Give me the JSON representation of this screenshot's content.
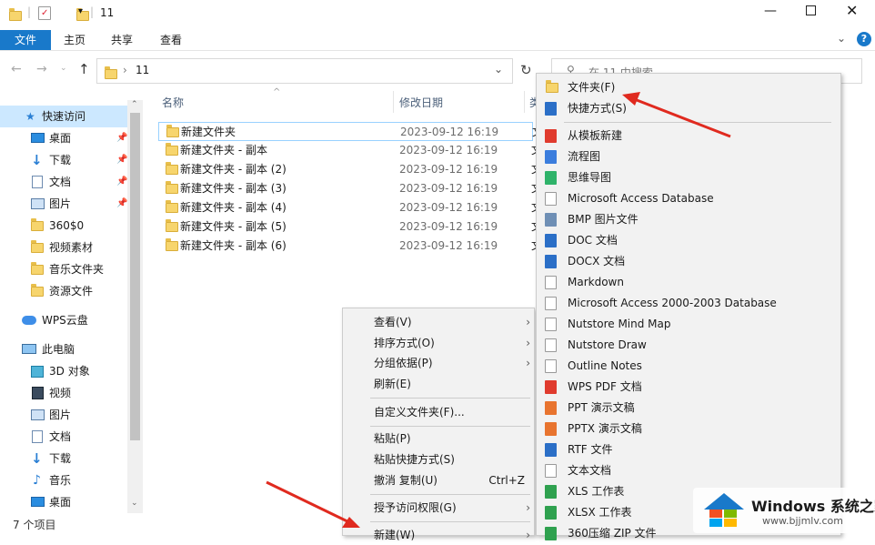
{
  "window": {
    "title": "11",
    "controls": [
      "minimize",
      "maximize",
      "close"
    ]
  },
  "ribbon": {
    "tabs": [
      "文件",
      "主页",
      "共享",
      "查看"
    ]
  },
  "navigation": {
    "address": "11",
    "search_placeholder": "在 11 中搜索"
  },
  "sidebar": {
    "quick_access": "快速访问",
    "items": [
      {
        "label": "桌面",
        "icon": "desktop-icon",
        "pinned": true
      },
      {
        "label": "下载",
        "icon": "download-icon",
        "pinned": true
      },
      {
        "label": "文档",
        "icon": "document-icon",
        "pinned": true
      },
      {
        "label": "图片",
        "icon": "picture-icon",
        "pinned": true
      },
      {
        "label": "360$0",
        "icon": "folder-icon",
        "pinned": false
      },
      {
        "label": "视频素材",
        "icon": "folder-icon",
        "pinned": false
      },
      {
        "label": "音乐文件夹",
        "icon": "folder-icon",
        "pinned": false
      },
      {
        "label": "资源文件",
        "icon": "folder-icon",
        "pinned": false
      }
    ],
    "wps_cloud": "WPS云盘",
    "this_pc": "此电脑",
    "pc_items": [
      {
        "label": "3D 对象",
        "icon": "3d-objects-icon"
      },
      {
        "label": "视频",
        "icon": "video-icon"
      },
      {
        "label": "图片",
        "icon": "picture-icon"
      },
      {
        "label": "文档",
        "icon": "document-icon"
      },
      {
        "label": "下载",
        "icon": "download-icon"
      },
      {
        "label": "音乐",
        "icon": "music-icon"
      },
      {
        "label": "桌面",
        "icon": "desktop-icon"
      }
    ]
  },
  "filelist": {
    "columns": {
      "name": "名称",
      "date": "修改日期",
      "type": "类"
    },
    "rows": [
      {
        "name": "新建文件夹",
        "date": "2023-09-12 16:19",
        "type": "文"
      },
      {
        "name": "新建文件夹 - 副本",
        "date": "2023-09-12 16:19",
        "type": "文"
      },
      {
        "name": "新建文件夹 - 副本 (2)",
        "date": "2023-09-12 16:19",
        "type": "文"
      },
      {
        "name": "新建文件夹 - 副本 (3)",
        "date": "2023-09-12 16:19",
        "type": "文"
      },
      {
        "name": "新建文件夹 - 副本 (4)",
        "date": "2023-09-12 16:19",
        "type": "文"
      },
      {
        "name": "新建文件夹 - 副本 (5)",
        "date": "2023-09-12 16:19",
        "type": "文"
      },
      {
        "name": "新建文件夹 - 副本 (6)",
        "date": "2023-09-12 16:19",
        "type": "文"
      }
    ]
  },
  "status": {
    "item_count": "7 个项目"
  },
  "context_menu": {
    "items": [
      {
        "label": "查看(V)",
        "submenu": true
      },
      {
        "label": "排序方式(O)",
        "submenu": true
      },
      {
        "label": "分组依据(P)",
        "submenu": true
      },
      {
        "label": "刷新(E)",
        "submenu": false
      },
      {
        "label": "自定义文件夹(F)...",
        "submenu": false
      },
      {
        "label": "粘贴(P)",
        "submenu": false
      },
      {
        "label": "粘贴快捷方式(S)",
        "submenu": false
      },
      {
        "label": "撤消 复制(U)",
        "shortcut": "Ctrl+Z",
        "submenu": false
      },
      {
        "label": "授予访问权限(G)",
        "submenu": true
      },
      {
        "label": "新建(W)",
        "submenu": true
      }
    ]
  },
  "new_submenu": {
    "items": [
      {
        "label": "文件夹(F)",
        "icon": "folder-icon",
        "color": "#f7d56d"
      },
      {
        "label": "快捷方式(S)",
        "icon": "shortcut-icon",
        "color": "#2b6fc7"
      },
      {
        "label": "从模板新建",
        "icon": "template-icon",
        "color": "#e03b2e"
      },
      {
        "label": "流程图",
        "icon": "flowchart-icon",
        "color": "#3b7ddd"
      },
      {
        "label": "思维导图",
        "icon": "mindmap-icon",
        "color": "#2fb36a"
      },
      {
        "label": "Microsoft Access Database",
        "icon": "blank-file-icon",
        "color": "#ffffff"
      },
      {
        "label": "BMP 图片文件",
        "icon": "bmp-icon",
        "color": "#6f8fb5"
      },
      {
        "label": "DOC 文档",
        "icon": "doc-icon",
        "color": "#2b6fc7"
      },
      {
        "label": "DOCX 文档",
        "icon": "docx-icon",
        "color": "#2b6fc7"
      },
      {
        "label": "Markdown",
        "icon": "blank-file-icon",
        "color": "#ffffff"
      },
      {
        "label": "Microsoft Access 2000-2003 Database",
        "icon": "blank-file-icon",
        "color": "#ffffff"
      },
      {
        "label": "Nutstore Mind Map",
        "icon": "blank-file-icon",
        "color": "#ffffff"
      },
      {
        "label": "Nutstore Draw",
        "icon": "blank-file-icon",
        "color": "#ffffff"
      },
      {
        "label": "Outline Notes",
        "icon": "blank-file-icon",
        "color": "#ffffff"
      },
      {
        "label": "WPS PDF 文档",
        "icon": "pdf-icon",
        "color": "#e03b2e"
      },
      {
        "label": "PPT 演示文稿",
        "icon": "ppt-icon",
        "color": "#e8742f"
      },
      {
        "label": "PPTX 演示文稿",
        "icon": "pptx-icon",
        "color": "#e8742f"
      },
      {
        "label": "RTF 文件",
        "icon": "rtf-icon",
        "color": "#2b6fc7"
      },
      {
        "label": "文本文档",
        "icon": "text-file-icon",
        "color": "#ffffff"
      },
      {
        "label": "XLS 工作表",
        "icon": "xls-icon",
        "color": "#2fa14f"
      },
      {
        "label": "XLSX 工作表",
        "icon": "xlsx-icon",
        "color": "#2fa14f"
      },
      {
        "label": "360压缩 ZIP 文件",
        "icon": "zip-icon",
        "color": "#2fa14f"
      }
    ]
  },
  "watermark": {
    "brand": "Windows 系统之家",
    "url": "www.bjjmlv.com"
  }
}
